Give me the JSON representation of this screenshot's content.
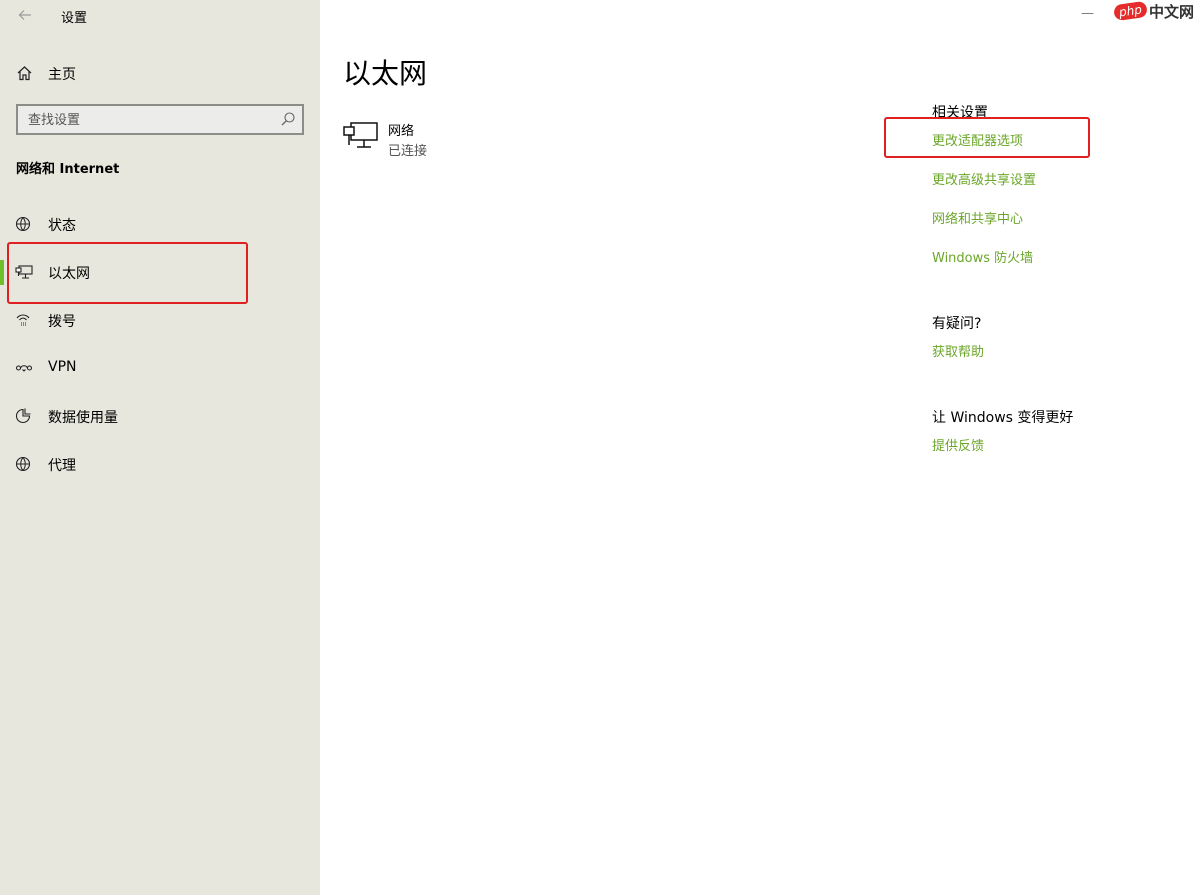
{
  "app": {
    "title": "设置",
    "back_icon": "back-arrow-icon"
  },
  "sidebar": {
    "home": {
      "label": "主页",
      "icon": "home-icon"
    },
    "search": {
      "placeholder": "查找设置",
      "icon": "search-icon"
    },
    "section_title": "网络和 Internet",
    "items": [
      {
        "label": "状态",
        "icon": "globe-status-icon",
        "active": false
      },
      {
        "label": "以太网",
        "icon": "ethernet-icon",
        "active": true
      },
      {
        "label": "拨号",
        "icon": "dialup-icon",
        "active": false
      },
      {
        "label": "VPN",
        "icon": "vpn-icon",
        "active": false
      },
      {
        "label": "数据使用量",
        "icon": "data-usage-icon",
        "active": false
      },
      {
        "label": "代理",
        "icon": "globe-icon",
        "active": false
      }
    ]
  },
  "main": {
    "title": "以太网",
    "network": {
      "name": "网络",
      "status": "已连接",
      "icon": "ethernet-computer-icon"
    },
    "related": {
      "heading": "相关设置",
      "links": [
        "更改适配器选项",
        "更改高级共享设置",
        "网络和共享中心",
        "Windows 防火墙"
      ]
    },
    "help": {
      "heading": "有疑问?",
      "link": "获取帮助"
    },
    "feedback": {
      "heading": "让 Windows 变得更好",
      "link": "提供反馈"
    }
  },
  "watermark": {
    "badge": "php",
    "text": "中文网"
  },
  "colors": {
    "accent": "#6fbe2c",
    "link": "#6ba62a",
    "sidebar_bg": "#e7e7dd",
    "highlight": "#e02020"
  }
}
